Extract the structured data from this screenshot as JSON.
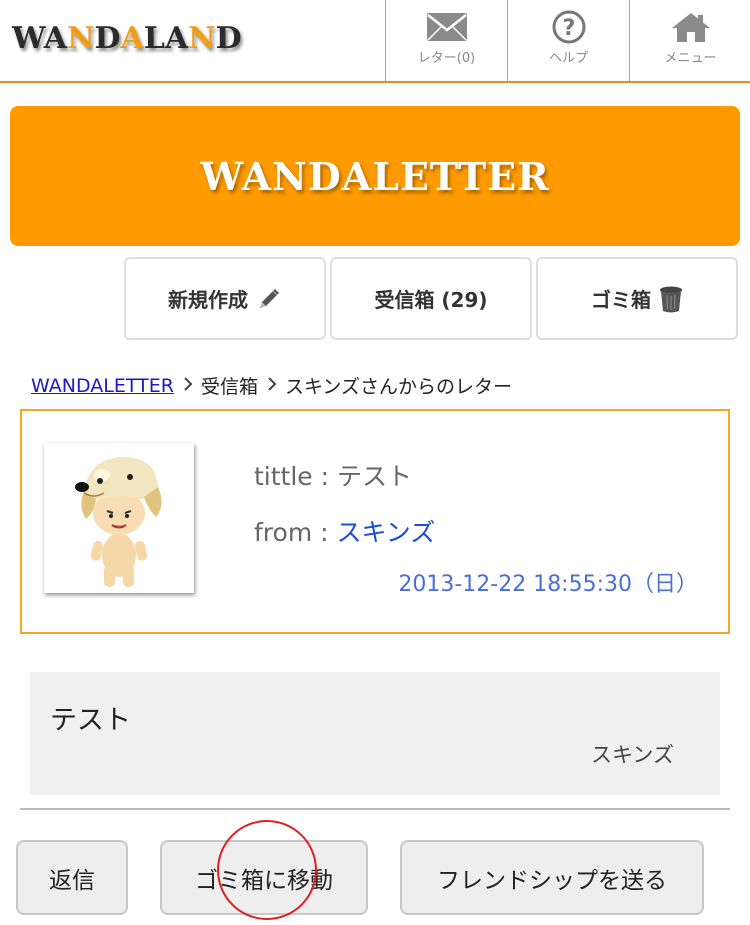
{
  "header": {
    "logo_parts": [
      {
        "text": "WA",
        "color": "#2b2b2b"
      },
      {
        "text": "N",
        "color": "#f39c12"
      },
      {
        "text": "D",
        "color": "#2b2b2b"
      },
      {
        "text": "A",
        "color": "#f39c12"
      },
      {
        "text": "LA",
        "color": "#2b2b2b"
      },
      {
        "text": "N",
        "color": "#f39c12"
      },
      {
        "text": "D",
        "color": "#2b2b2b"
      }
    ],
    "nav": {
      "letter": {
        "label": "レター(0)",
        "icon": "envelope-icon"
      },
      "help": {
        "label": "ヘルプ",
        "icon": "question-icon"
      },
      "menu": {
        "label": "メニュー",
        "icon": "home-icon"
      }
    }
  },
  "banner": {
    "title": "WANDALETTER",
    "color": "#ff9a00"
  },
  "tabs": {
    "new": {
      "label": "新規作成",
      "icon": "pencil-icon"
    },
    "inbox": {
      "label": "受信箱 (29)"
    },
    "trash": {
      "label": "ゴミ箱",
      "icon": "trash-can-icon"
    }
  },
  "breadcrumb": {
    "root": "WANDALETTER",
    "items": [
      "受信箱",
      "スキンズさんからのレター"
    ]
  },
  "letter": {
    "title_label": "tittle : ",
    "title": "テスト",
    "from_label": "from : ",
    "from": "スキンズ",
    "date": "2013-12-22 18:55:30（日）",
    "avatar": "dog-avatar"
  },
  "message": {
    "body": "テスト",
    "signature": "スキンズ"
  },
  "actions": {
    "reply": "返信",
    "move_to_trash": "ゴミ箱に移動",
    "send_friendship": "フレンドシップを送る"
  }
}
